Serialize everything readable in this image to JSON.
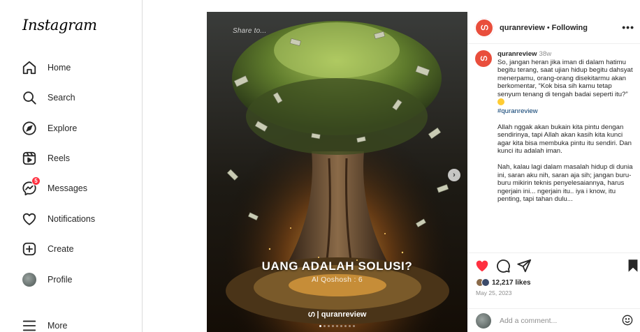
{
  "app": {
    "logo": "Instagram"
  },
  "sidebar": {
    "items": [
      {
        "label": "Home",
        "icon": "home-icon"
      },
      {
        "label": "Search",
        "icon": "search-icon"
      },
      {
        "label": "Explore",
        "icon": "compass-icon"
      },
      {
        "label": "Reels",
        "icon": "reels-icon"
      },
      {
        "label": "Messages",
        "icon": "messenger-icon",
        "badge": "5"
      },
      {
        "label": "Notifications",
        "icon": "heart-icon"
      },
      {
        "label": "Create",
        "icon": "plus-square-icon"
      },
      {
        "label": "Profile",
        "icon": "profile-avatar"
      },
      {
        "label": "More",
        "icon": "hamburger-icon"
      }
    ]
  },
  "post": {
    "media": {
      "share_overlay": "Share to...",
      "title": "UANG ADALAH SOLUSI?",
      "subtitle": "Al Qoshosh : 6",
      "brand": "quranreview",
      "slide_count": 9,
      "active_slide": 0
    },
    "header": {
      "username": "quranreview",
      "separator": "•",
      "follow_status": "Following",
      "more_label": "•••"
    },
    "caption": {
      "username": "quranreview",
      "time": "38w",
      "paragraph_1": "So, jangan heran jika iman di dalam hatimu begitu terang, saat ujian hidup begitu dahsyat menerpamu, orang-orang disekitarmu akan berkomentar, “Kok bisa sih kamu tetap senyum tenang di tengah badai seperti itu?”",
      "hashtag": "#quranreview",
      "paragraph_2": "Allah nggak akan bukain kita pintu dengan sendirinya, tapi Allah akan kasih kita kunci agar kita bisa membuka pintu itu sendiri. Dan kunci itu adalah iman.",
      "paragraph_3": "Nah, kalau lagi dalam masalah hidup di dunia ini, saran aku nih, saran aja sih; jangan buru-buru mikirin teknis penyelesaiannya, harus ngerjain ini... ngerjain itu.. iya i know, itu penting, tapi tahan dulu..."
    },
    "likes": "12,217 likes",
    "date": "May 25, 2023",
    "comment_placeholder": "Add a comment...",
    "colors": {
      "like_red": "#ff3040",
      "brand_avatar": "#e94e3c",
      "hashtag_blue": "#00376b"
    }
  }
}
